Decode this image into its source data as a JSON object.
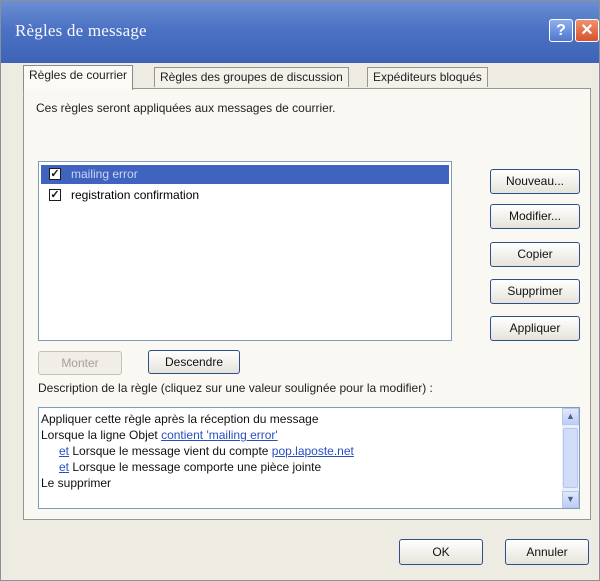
{
  "window": {
    "title": "Règles de message",
    "help_glyph": "?",
    "close_glyph": "✕"
  },
  "tabs": [
    {
      "label": "Règles de courrier",
      "active": true
    },
    {
      "label": "Règles des groupes de discussion",
      "active": false
    },
    {
      "label": "Expéditeurs bloqués",
      "active": false
    }
  ],
  "intro_text": "Ces règles seront appliquées aux messages de courrier.",
  "rules": [
    {
      "label": "mailing error",
      "checked": true,
      "selected": true
    },
    {
      "label": "registration confirmation",
      "checked": true,
      "selected": false
    }
  ],
  "side_buttons": {
    "new": "Nouveau...",
    "modify": "Modifier...",
    "copy": "Copier",
    "delete": "Supprimer",
    "apply": "Appliquer"
  },
  "move": {
    "up": "Monter",
    "down": "Descendre"
  },
  "description": {
    "label": "Description de la règle (cliquez sur une valeur soulignée pour la modifier) :",
    "line1": "Appliquer cette règle après la réception du message",
    "line2_text": "Lorsque la ligne Objet ",
    "line2_link": "contient 'mailing error'",
    "line3_link": "et",
    "line3_text": " Lorsque le message vient du compte ",
    "line3_account": "pop.laposte.net",
    "line4_link": "et",
    "line4_text": " Lorsque le message comporte une pièce jointe",
    "line5": "Le supprimer"
  },
  "dialog_buttons": {
    "ok": "OK",
    "cancel": "Annuler"
  },
  "check_glyph": "✓",
  "colors": {
    "titlebar": "#4c72c4",
    "selection": "#3f63bf",
    "link": "#2a4ec0"
  },
  "icons": [
    "help-icon",
    "close-icon",
    "checkbox-checked-icon",
    "scroll-up-icon",
    "scroll-down-icon"
  ]
}
